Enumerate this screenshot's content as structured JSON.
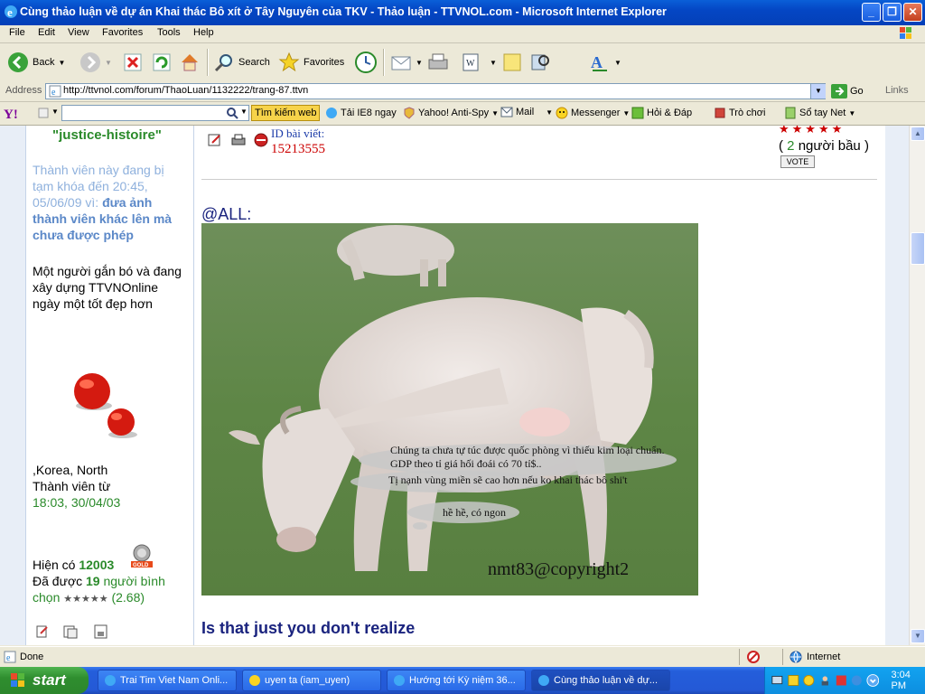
{
  "window": {
    "title": "Cùng tho luon v dn Khai thác Bô xít  Tây Nguyên ca TKV - Tho lun - TTVNOL.com - Microsoft Internet Explorer",
    "title_display": "Cùng thảo luận về dự án Khai thác Bô xít ở Tây Nguyên của TKV - Thảo luận - TTVNOL.com - Microsoft Internet Explorer",
    "minimize": "_",
    "maximize": "❐",
    "close": "✕"
  },
  "menu": [
    "File",
    "Edit",
    "View",
    "Favorites",
    "Tools",
    "Help"
  ],
  "toolbar": {
    "back_label": "Back",
    "search_label": "Search",
    "favorites_label": "Favorites"
  },
  "address": {
    "label": "Address",
    "url": "http://ttvnol.com/forum/ThaoLuan/1132222/trang-87.ttvn",
    "go_label": "Go",
    "links_label": "Links"
  },
  "yahoo": {
    "search_button": "Tìm kiếm web",
    "items": [
      "Tải IE8 ngay",
      "Yahoo! Anti-Spy",
      "Mail",
      "Messenger",
      "Hỏi & Đáp",
      "Trò chơi",
      "Sổ tay Net"
    ]
  },
  "sidebar": {
    "username": "\"justice-histoire\"",
    "ban_prefix": "Thành viên này đang bị tạm khóa đến",
    "ban_date": "20:45, 05/06/09 vì:",
    "ban_reason": "đưa ảnh thành viên khác lên mà chưa được phép",
    "tagline": "Một người gắn bó và đang xây dựng TTVNOnline ngày một tốt đẹp hơn",
    "location": ",Korea, North",
    "member_since_label": "Thành viên từ",
    "member_since": "18:03, 30/04/03",
    "points_label": "Hiện có",
    "points": "12003",
    "gold_label": "GOLD",
    "rated_prefix": "Đã được",
    "rated_count": "19",
    "rated_suffix": "người bình chọn",
    "rating_stars": "★★★★★",
    "rating_value": "(2.68)"
  },
  "post": {
    "id_label": "ID bài viết:",
    "id_value": "15213555",
    "stars": "★★★★★",
    "voters_open": "(",
    "voters_count": "2",
    "voters_suffix": "người bầu )",
    "vote_button": "VOTE",
    "greeting": "@ALL:",
    "image_caption_1": "Chúng ta chưa tự túc được quốc phòng vì thiếu kim loại chuẩn. GDP theo tỉ giá hối đoái có 70 tỉ$..",
    "image_caption_2": "Tị nạnh vùng miền sẽ cao hơn nếu ko khai thác bô shi't",
    "image_caption_3": "hề hề, có ngon",
    "image_watermark": "nmt83@copyright2",
    "footer_text": "Is that just you don't realize"
  },
  "status": {
    "text": "Done",
    "zone": "Internet"
  },
  "taskbar": {
    "start_label": "start",
    "tasks": [
      "Trai Tim Viet Nam Onli...",
      "uyen ta (iam_uyen)",
      "Hướng tới Kỳ niệm 36...",
      "Cùng thảo luận về dự..."
    ],
    "clock": "3:04 PM"
  },
  "colors": {
    "title_blue": "#0446c4",
    "link_green": "#2a8a2a",
    "id_red": "#cc0000",
    "footer_navy": "#1a237e"
  }
}
